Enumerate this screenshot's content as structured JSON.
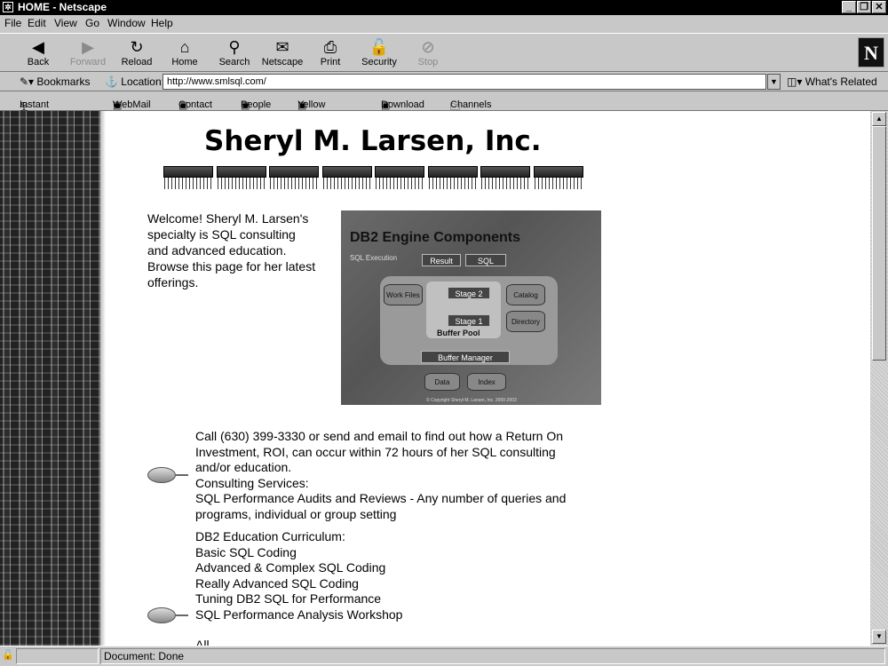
{
  "window": {
    "title": "HOME - Netscape"
  },
  "menu": [
    "File",
    "Edit",
    "View",
    "Go",
    "Window",
    "Help"
  ],
  "toolbar": [
    "Back",
    "Forward",
    "Reload",
    "Home",
    "Search",
    "Netscape",
    "Print",
    "Security",
    "Stop"
  ],
  "location": {
    "bookmarks": "Bookmarks",
    "label": "Location:",
    "url": "http://www.smlsql.com/",
    "related": "What's Related"
  },
  "personal": [
    "Instant Message",
    "WebMail",
    "Contact",
    "People",
    "Yellow Pages",
    "Download",
    "Channels"
  ],
  "page": {
    "heading": "Sheryl M. Larsen, Inc.",
    "welcome": [
      "Welcome! Sheryl M. Larsen's",
      "specialty is SQL consulting",
      "and advanced education.",
      "Browse this page for her latest",
      "offerings."
    ],
    "db2": {
      "title": "DB2 Engine Components",
      "subtitle": "SQL Execution",
      "result": "Result",
      "sql": "SQL",
      "stage2": "Stage 2",
      "stage1": "Stage 1",
      "workfiles": "Work Files",
      "catalog": "Catalog",
      "directory": "Directory",
      "bufferpool": "Buffer Pool",
      "buffermanager": "Buffer Manager",
      "data": "Data",
      "index": "Index",
      "copyright": "© Copyright Sheryl M. Larsen, Inc. 2000-2003"
    },
    "p1": [
      "Call (630) 399-3330 or send and email to find out how a Return On",
      "Investment, ROI, can occur within 72 hours of her SQL consulting",
      "and/or education.",
      "Consulting Services:",
      "SQL Performance Audits and Reviews - Any number of queries and",
      "programs, individual or group setting"
    ],
    "p2": [
      "DB2 Education Curriculum:",
      "Basic SQL Coding",
      "Advanced & Complex SQL Coding",
      "Really Advanced SQL Coding",
      "Tuning DB2 SQL for Performance",
      "SQL Performance Analysis Workshop"
    ],
    "p3": "All ..."
  },
  "status": {
    "text": "Document: Done"
  }
}
